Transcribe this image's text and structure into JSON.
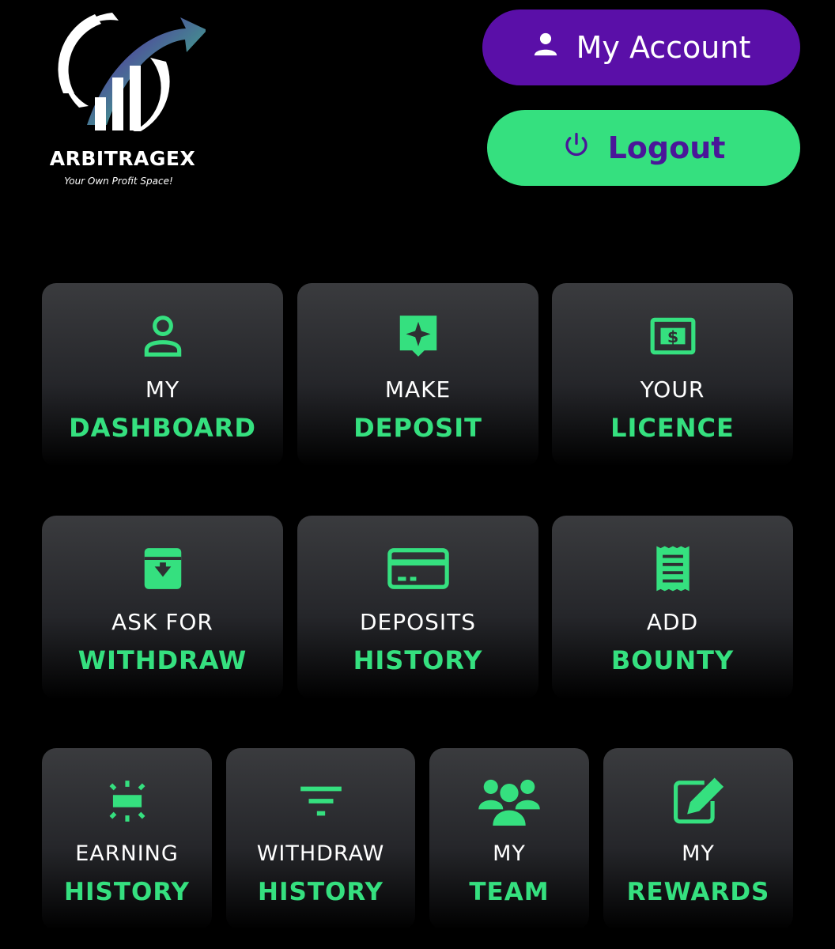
{
  "logo": {
    "brand": "ARBITRAGEX",
    "tagline": "Your Own Profit Space!"
  },
  "header": {
    "account_label": "My Account",
    "logout_label": "Logout"
  },
  "colors": {
    "accent_green": "#35e07f",
    "accent_purple": "#5a0fa8",
    "logout_text": "#4a1699",
    "tile_bg": "#2e2f32"
  },
  "tiles": [
    {
      "line1": "MY",
      "line2": "DASHBOARD",
      "icon": "user-icon"
    },
    {
      "line1": "MAKE",
      "line2": "DEPOSIT",
      "icon": "sparkle-chat-icon"
    },
    {
      "line1": "YOUR",
      "line2": "LICENCE",
      "icon": "dollar-bill-icon"
    },
    {
      "line1": "ASK FOR",
      "line2": "WITHDRAW",
      "icon": "archive-down-icon"
    },
    {
      "line1": "DEPOSITS",
      "line2": "HISTORY",
      "icon": "credit-card-icon"
    },
    {
      "line1": "ADD",
      "line2": "BOUNTY",
      "icon": "receipt-icon"
    },
    {
      "line1": "EARNING",
      "line2": "HISTORY",
      "icon": "sparkle-box-icon"
    },
    {
      "line1": "WITHDRAW",
      "line2": "HISTORY",
      "icon": "filter-icon"
    },
    {
      "line1": "MY",
      "line2": "TEAM",
      "icon": "team-icon"
    },
    {
      "line1": "MY",
      "line2": "REWARDS",
      "icon": "edit-icon"
    }
  ]
}
